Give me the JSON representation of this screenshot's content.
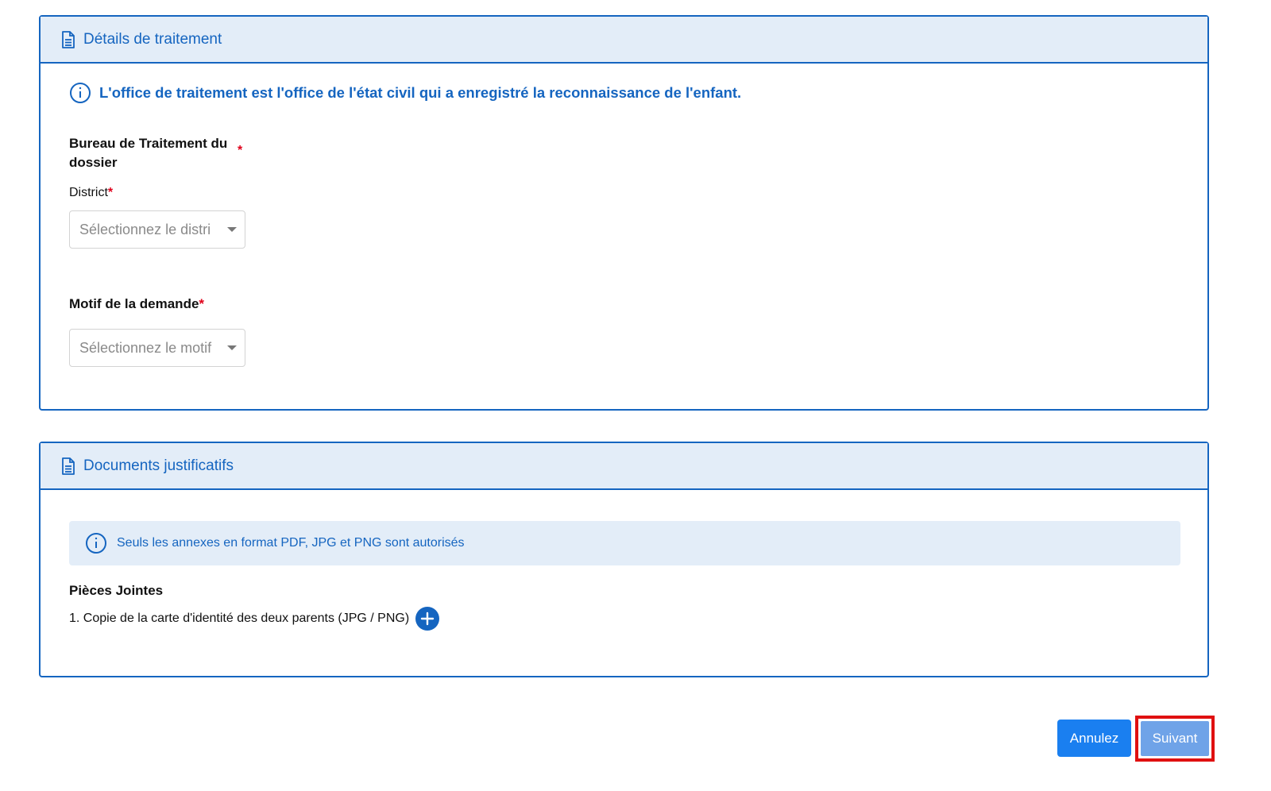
{
  "details_card": {
    "title": "Détails de traitement",
    "info_text": "L'office de traitement est l'office de l'état civil qui a enregistré la reconnaissance de l'enfant.",
    "bureau_label": "Bureau de Traitement du dossier",
    "required_mark": "*",
    "district_label": "District",
    "district_placeholder": "Sélectionnez le distri",
    "motif_label": "Motif de la demande",
    "motif_placeholder": "Sélectionnez le motif"
  },
  "documents_card": {
    "title": "Documents justificatifs",
    "alert_text": "Seuls les annexes en format PDF, JPG et PNG sont autorisés",
    "attachments_label": "Pièces Jointes",
    "attachments": [
      {
        "label": "1. Copie de la carte d'identité des deux parents (JPG / PNG)"
      }
    ]
  },
  "actions": {
    "cancel_label": "Annulez",
    "next_label": "Suivant"
  },
  "colors": {
    "primary": "#1565c0",
    "header_bg": "#e3edf8",
    "required": "#e0001a",
    "highlight": "#e01010"
  },
  "icons": {
    "card_header": "document-icon",
    "info": "info-circle-icon",
    "add": "plus-icon",
    "dropdown": "caret-down-icon"
  }
}
